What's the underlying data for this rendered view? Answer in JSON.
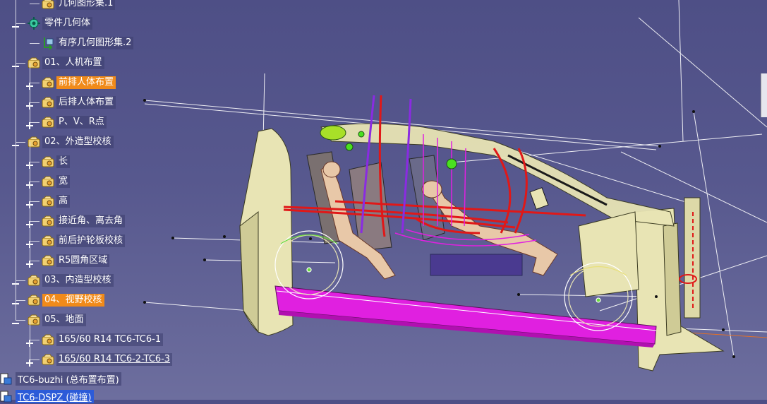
{
  "tree": {
    "items": [
      {
        "label": "几何图形集.1",
        "level": 2,
        "icon": "geometry-set-icon"
      },
      {
        "label": "零件几何体",
        "level": 1,
        "icon": "part-body-gear-icon"
      },
      {
        "label": "有序几何图形集.2",
        "level": 2,
        "icon": "ordered-geometry-set-icon"
      },
      {
        "label": "01、人机布置",
        "level": 1,
        "icon": "geometry-set-icon"
      },
      {
        "label": "前排人体布置",
        "level": 2,
        "icon": "geometry-set-icon",
        "highlighted": true
      },
      {
        "label": "后排人体布置",
        "level": 2,
        "icon": "geometry-set-icon"
      },
      {
        "label": "P、V、R点",
        "level": 2,
        "icon": "geometry-set-icon"
      },
      {
        "label": "02、外造型校核",
        "level": 1,
        "icon": "geometry-set-icon"
      },
      {
        "label": "长",
        "level": 2,
        "icon": "geometry-set-icon"
      },
      {
        "label": "宽",
        "level": 2,
        "icon": "geometry-set-icon"
      },
      {
        "label": "高",
        "level": 2,
        "icon": "geometry-set-icon"
      },
      {
        "label": "接近角、离去角",
        "level": 2,
        "icon": "geometry-set-icon"
      },
      {
        "label": "前后护轮板校核",
        "level": 2,
        "icon": "geometry-set-icon"
      },
      {
        "label": "R5圆角区域",
        "level": 2,
        "icon": "geometry-set-icon"
      },
      {
        "label": "03、内造型校核",
        "level": 1,
        "icon": "geometry-set-icon"
      },
      {
        "label": "04、视野校核",
        "level": 1,
        "icon": "geometry-set-icon",
        "highlighted": true
      },
      {
        "label": "05、地面",
        "level": 1,
        "icon": "geometry-set-icon"
      },
      {
        "label": "165/60 R14 TC6-TC6-1",
        "level": 2,
        "icon": "geometry-set-icon"
      },
      {
        "label": "165/60 R14 TC6-2-TC6-3",
        "level": 2,
        "icon": "geometry-set-icon",
        "underlined": true
      }
    ]
  },
  "documents": [
    {
      "label": "TC6-buzhi (总布置布置)",
      "icon": "product-icon"
    },
    {
      "label": "TC6-DSPZ (碰撞)",
      "icon": "product-icon",
      "selected": true
    }
  ],
  "colors": {
    "background_top": "#4e4f86",
    "background_bottom": "#6d6e9e",
    "highlight": "#f08a1a",
    "selection": "#2c5bd8",
    "body_panel": "#e8e4b4",
    "magenta": "#e020e0",
    "red_curve": "#e01818",
    "purple_curve": "#8a2be2"
  }
}
